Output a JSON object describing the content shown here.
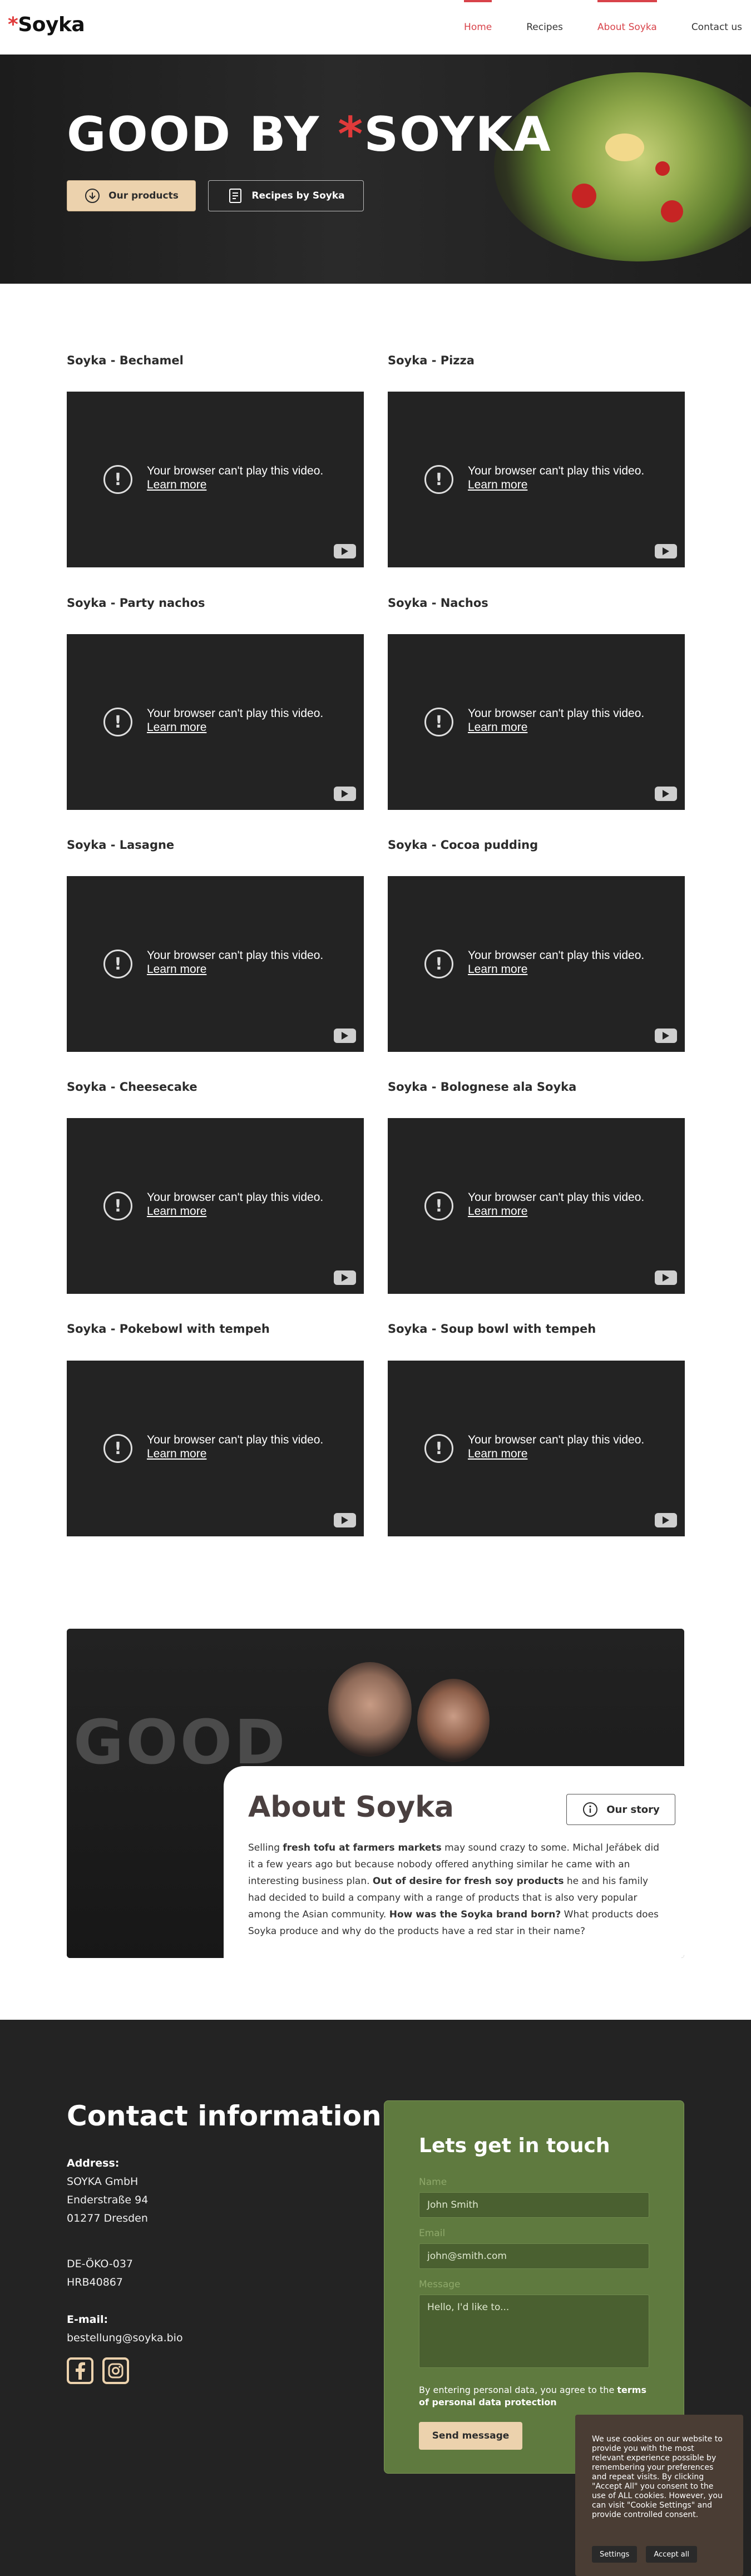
{
  "brand": {
    "star": "*",
    "name": "Soyka"
  },
  "nav": {
    "items": [
      {
        "label": "Home",
        "active": true
      },
      {
        "label": "Recipes",
        "active": false
      },
      {
        "label": "About Soyka",
        "active": true
      },
      {
        "label": "Contact us",
        "active": false
      }
    ]
  },
  "hero": {
    "title_prefix": "GOOD BY ",
    "title_star": "*",
    "title_brand": "SOYKA",
    "btn_products": "Our products",
    "btn_recipes": "Recipes by Soyka"
  },
  "videos": {
    "error_text": "Your browser can't play this video.",
    "learn_more": "Learn more",
    "items": [
      {
        "title": "Soyka - Bechamel"
      },
      {
        "title": "Soyka - Pizza"
      },
      {
        "title": "Soyka - Party nachos"
      },
      {
        "title": "Soyka - Nachos"
      },
      {
        "title": "Soyka - Lasagne"
      },
      {
        "title": "Soyka - Cocoa pudding"
      },
      {
        "title": "Soyka - Cheesecake"
      },
      {
        "title": "Soyka - Bolognese ala Soyka"
      },
      {
        "title": "Soyka - Pokebowl with tempeh"
      },
      {
        "title": "Soyka - Soup bowl with tempeh"
      }
    ]
  },
  "about": {
    "title": "About Soyka",
    "btn_story": "Our story",
    "photo_text": "GOOD",
    "p1": "Selling ",
    "b1": "fresh tofu at farmers markets",
    "p2": " may sound crazy to some. Michal Jeřábek did it a few years ago but because nobody offered anything similar he came with an interesting business plan. ",
    "b2": "Out of desire for fresh soy products",
    "p3": " he and his family had decided to build a company with a range of products that is also very popular among the Asian community. ",
    "b3": "How was the Soyka brand born?",
    "p4": " What products does Soyka produce and why do the products have a red star in their name?"
  },
  "contact": {
    "title": "Contact information",
    "address_label": "Address:",
    "address_lines": [
      "SOYKA GmbH",
      "Enderstraße 94",
      "01277 Dresden"
    ],
    "reg_lines": [
      "DE-ÖKO-037",
      "HRB40867"
    ],
    "email_label": "E-mail:",
    "email": "bestellung@soyka.bio"
  },
  "form": {
    "title": "Lets get in touch",
    "name_label": "Name",
    "name_placeholder": "John Smith",
    "email_label": "Email",
    "email_placeholder": "john@smith.com",
    "message_label": "Message",
    "message_placeholder": "Hello, I'd like to...",
    "note_prefix": "By entering personal data, you agree to the ",
    "note_link": "terms of personal data protection",
    "send": "Send message"
  },
  "cookie": {
    "text": "We use cookies on our website to provide you with the most relevant experience possible by remembering your preferences and repeat visits. By clicking \"Accept All\" you consent to the use of ALL cookies. However, you can visit \"Cookie Settings\" and provide controlled consent.",
    "settings": "Settings",
    "accept": "Accept all"
  },
  "colors": {
    "accent_red": "#d8434a",
    "beige": "#ecd2ad",
    "form_green": "#5f7a3f",
    "dark_bg": "#232323"
  },
  "icons": [
    "download-icon",
    "recipe-book-icon",
    "info-icon",
    "facebook-icon",
    "instagram-icon",
    "youtube-icon",
    "alert-icon"
  ]
}
